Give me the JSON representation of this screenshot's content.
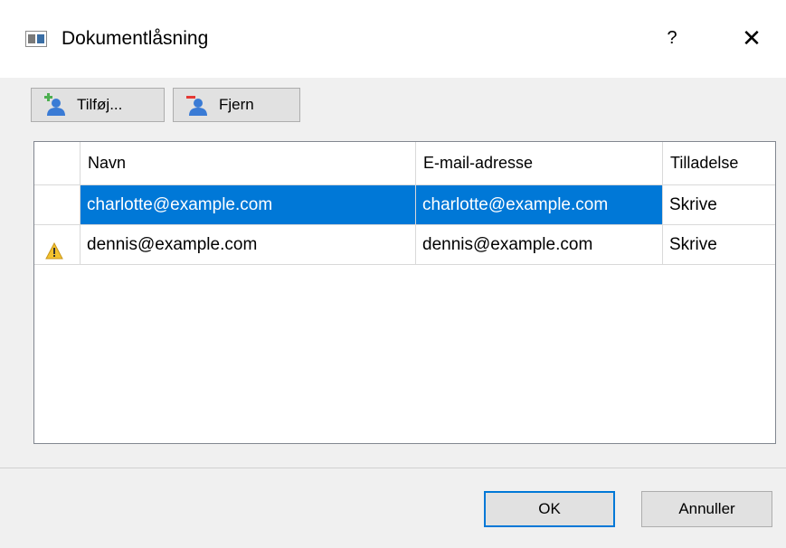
{
  "window": {
    "title": "Dokumentlåsning",
    "help_label": "?",
    "close_label": "✕"
  },
  "toolbar": {
    "add_label": "Tilføj...",
    "remove_label": "Fjern"
  },
  "table": {
    "columns": [
      "",
      "Navn",
      "E-mail-adresse",
      "Tilladelse"
    ],
    "rows": [
      {
        "status_icon": "none",
        "name": "charlotte@example.com",
        "email": "charlotte@example.com",
        "permission": "Skrive",
        "selected": true
      },
      {
        "status_icon": "warning-icon",
        "name": "dennis@example.com",
        "email": "dennis@example.com",
        "permission": "Skrive",
        "selected": false
      }
    ]
  },
  "footer": {
    "ok_label": "OK",
    "cancel_label": "Annuller"
  },
  "colors": {
    "selection": "#0078d7",
    "warning": "#f2c12e",
    "add_accent": "#4caf50",
    "remove_accent": "#e53935",
    "user_icon": "#3a7bd5"
  }
}
